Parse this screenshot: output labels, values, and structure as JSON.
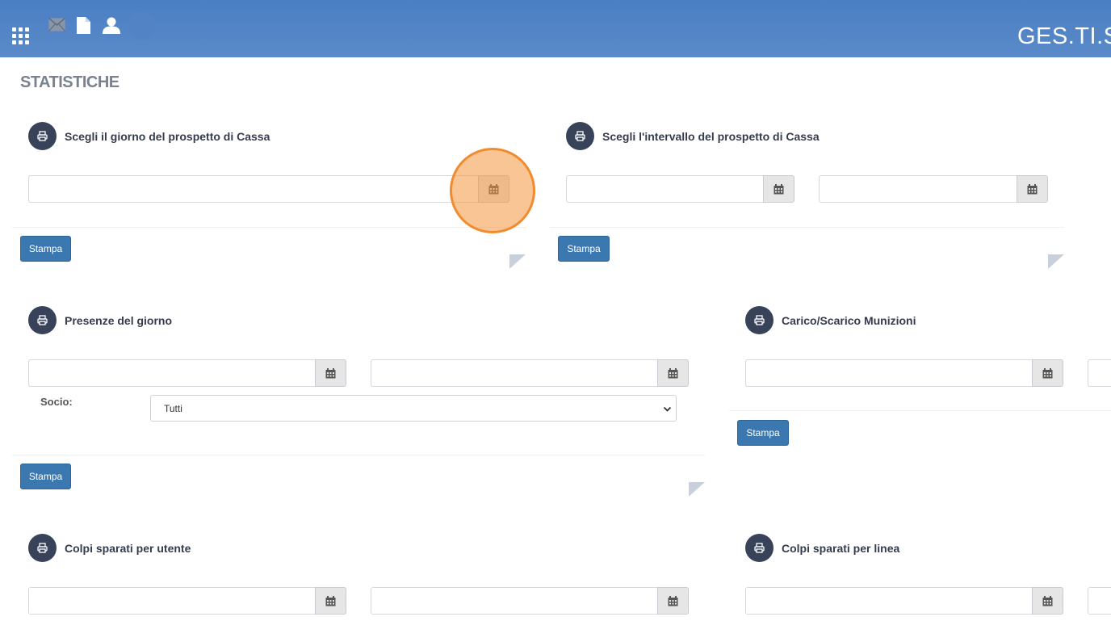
{
  "header": {
    "brand": "GES.TI.S",
    "icons": [
      "apps-grid-icon",
      "envelope-icon",
      "document-icon",
      "user-icon",
      "avatar"
    ]
  },
  "page": {
    "title": "STATISTICHE"
  },
  "widgets": {
    "cassa_giorno": {
      "title": "Scegli il giorno del prospetto di Cassa",
      "date_value": "",
      "print_label": "Stampa"
    },
    "cassa_intervallo": {
      "title": "Scegli l'intervallo del prospetto di Cassa",
      "date_from": "",
      "date_to": "",
      "print_label": "Stampa"
    },
    "presenze": {
      "title": "Presenze del giorno",
      "date_from": "",
      "date_to": "",
      "socio_label": "Socio:",
      "socio_selected": "Tutti",
      "print_label": "Stampa"
    },
    "munizioni": {
      "title": "Carico/Scarico Munizioni",
      "date_from": "",
      "print_label": "Stampa"
    },
    "colpi_utente": {
      "title": "Colpi sparati per utente",
      "date_from": "",
      "date_to": ""
    },
    "colpi_linea": {
      "title": "Colpi sparati per linea",
      "date_from": ""
    }
  },
  "colors": {
    "header_bg": "#4a7fc4",
    "badge_bg": "#38435a",
    "button_bg": "#3c78b0",
    "highlight": "#f08c2e"
  }
}
